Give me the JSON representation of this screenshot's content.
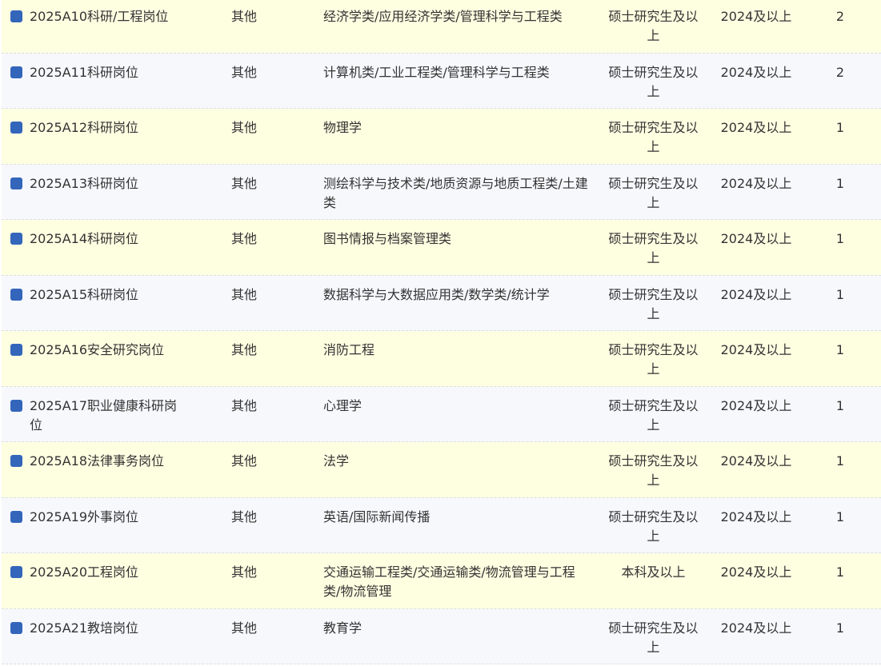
{
  "colors": {
    "row_odd_bg": "#fefee1",
    "row_even_bg": "#f7f8fc",
    "checkbox_fill": "#3366bb",
    "divider": "#d9dfe8"
  },
  "rows": [
    {
      "name": "2025A10科研/工程岗位",
      "type": "其他",
      "major": "经济学类/应用经济学类/管理科学与工程类",
      "education": "硕士研究生及以上",
      "year": "2024及以上",
      "count": "2"
    },
    {
      "name": "2025A11科研岗位",
      "type": "其他",
      "major": "计算机类/工业工程类/管理科学与工程类",
      "education": "硕士研究生及以上",
      "year": "2024及以上",
      "count": "2"
    },
    {
      "name": "2025A12科研岗位",
      "type": "其他",
      "major": "物理学",
      "education": "硕士研究生及以上",
      "year": "2024及以上",
      "count": "1"
    },
    {
      "name": "2025A13科研岗位",
      "type": "其他",
      "major": "测绘科学与技术类/地质资源与地质工程类/土建类",
      "education": "硕士研究生及以上",
      "year": "2024及以上",
      "count": "1"
    },
    {
      "name": "2025A14科研岗位",
      "type": "其他",
      "major": "图书情报与档案管理类",
      "education": "硕士研究生及以上",
      "year": "2024及以上",
      "count": "1"
    },
    {
      "name": "2025A15科研岗位",
      "type": "其他",
      "major": "数据科学与大数据应用类/数学类/统计学",
      "education": "硕士研究生及以上",
      "year": "2024及以上",
      "count": "1"
    },
    {
      "name": "2025A16安全研究岗位",
      "type": "其他",
      "major": "消防工程",
      "education": "硕士研究生及以上",
      "year": "2024及以上",
      "count": "1"
    },
    {
      "name": "2025A17职业健康科研岗位",
      "type": "其他",
      "major": "心理学",
      "education": "硕士研究生及以上",
      "year": "2024及以上",
      "count": "1"
    },
    {
      "name": "2025A18法律事务岗位",
      "type": "其他",
      "major": "法学",
      "education": "硕士研究生及以上",
      "year": "2024及以上",
      "count": "1"
    },
    {
      "name": "2025A19外事岗位",
      "type": "其他",
      "major": "英语/国际新闻传播",
      "education": "硕士研究生及以上",
      "year": "2024及以上",
      "count": "1"
    },
    {
      "name": "2025A20工程岗位",
      "type": "其他",
      "major": "交通运输工程类/交通运输类/物流管理与工程类/物流管理",
      "education": "本科及以上",
      "year": "2024及以上",
      "count": "1"
    },
    {
      "name": "2025A21教培岗位",
      "type": "其他",
      "major": "教育学",
      "education": "硕士研究生及以上",
      "year": "2024及以上",
      "count": "1"
    }
  ]
}
